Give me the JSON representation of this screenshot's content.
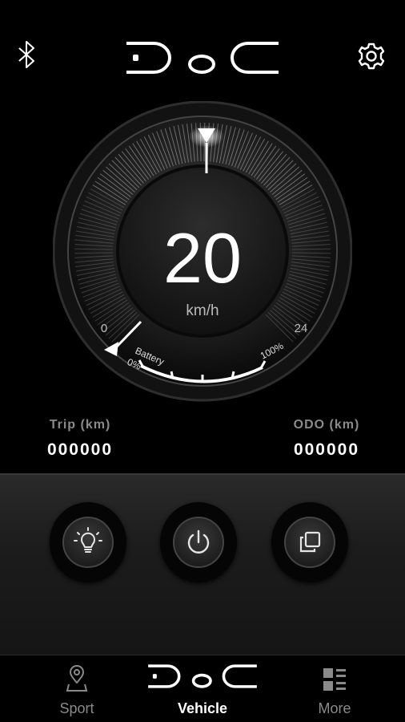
{
  "header": {
    "bluetooth_icon": "bluetooth-icon",
    "logo_text": "DoC",
    "settings_icon": "gear-icon"
  },
  "gauge": {
    "speed": "20",
    "unit": "km/h",
    "scale_min": "0",
    "scale_max": "24",
    "battery_label": "Battery",
    "battery_min": "0%",
    "battery_max": "100%"
  },
  "stats": {
    "trip_label": "Trip (km)",
    "trip_value": "000000",
    "odo_label": "ODO (km)",
    "odo_value": "000000"
  },
  "controls": {
    "light_icon": "lightbulb-icon",
    "power_icon": "power-icon",
    "copy_icon": "copy-icon"
  },
  "nav": {
    "items": [
      {
        "label": "Sport",
        "icon": "map-pin-icon",
        "active": false
      },
      {
        "label": "Vehicle",
        "icon": "doc-logo-icon",
        "active": true
      },
      {
        "label": "More",
        "icon": "grid-list-icon",
        "active": false
      }
    ]
  }
}
